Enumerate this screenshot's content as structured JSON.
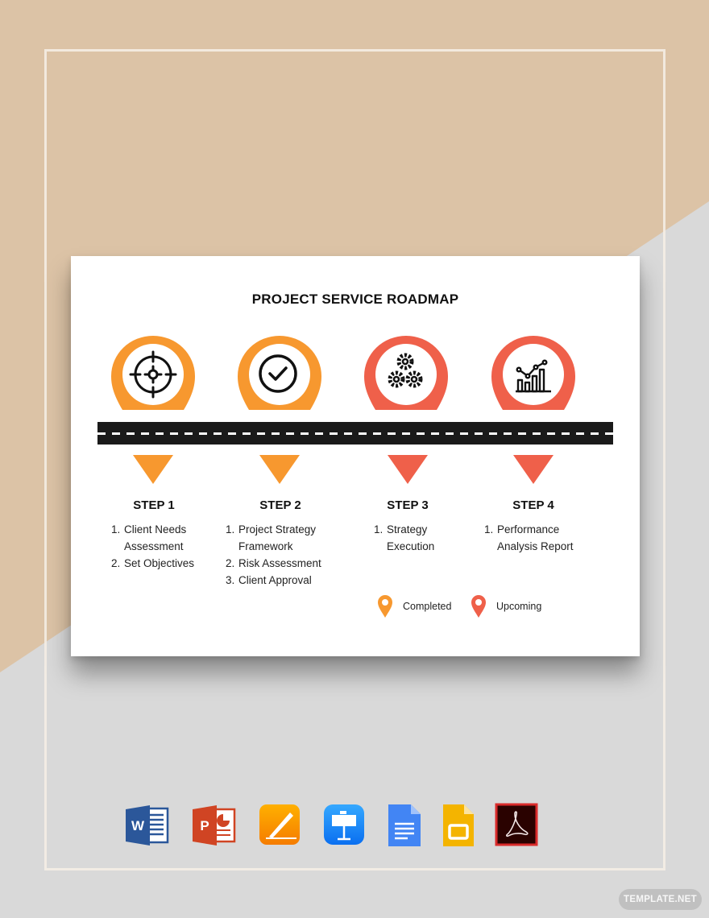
{
  "document": {
    "title": "PROJECT SERVICE ROADMAP",
    "colors": {
      "completed": "#f7982f",
      "upcoming": "#ef604a",
      "road": "#1a1a1a"
    },
    "steps": [
      {
        "label": "STEP 1",
        "status": "completed",
        "icon": "target-icon",
        "items": [
          {
            "num": "1.",
            "lines": [
              "Client Needs",
              "Assessment"
            ]
          },
          {
            "num": "2.",
            "lines": [
              "Set Objectives"
            ]
          }
        ]
      },
      {
        "label": "STEP 2",
        "status": "completed",
        "icon": "checkmark-circle-icon",
        "items": [
          {
            "num": "1.",
            "lines": [
              "Project Strategy",
              "Framework"
            ]
          },
          {
            "num": "2.",
            "lines": [
              "Risk Assessment"
            ]
          },
          {
            "num": "3.",
            "lines": [
              "Client Approval"
            ]
          }
        ]
      },
      {
        "label": "STEP 3",
        "status": "upcoming",
        "icon": "gears-icon",
        "items": [
          {
            "num": "1.",
            "lines": [
              "Strategy",
              "Execution"
            ]
          }
        ]
      },
      {
        "label": "STEP 4",
        "status": "upcoming",
        "icon": "growth-chart-icon",
        "items": [
          {
            "num": "1.",
            "lines": [
              "Performance",
              "Analysis Report"
            ]
          }
        ]
      }
    ],
    "legend": [
      {
        "label": "Completed",
        "status": "completed"
      },
      {
        "label": "Upcoming",
        "status": "upcoming"
      }
    ]
  },
  "formats": [
    {
      "name": "Microsoft Word",
      "icon": "word-icon"
    },
    {
      "name": "Microsoft PowerPoint",
      "icon": "powerpoint-icon"
    },
    {
      "name": "Apple Pages",
      "icon": "pages-icon"
    },
    {
      "name": "Apple Keynote",
      "icon": "keynote-icon"
    },
    {
      "name": "Google Docs",
      "icon": "google-docs-icon"
    },
    {
      "name": "Google Slides",
      "icon": "google-slides-icon"
    },
    {
      "name": "Adobe PDF",
      "icon": "adobe-pdf-icon"
    }
  ],
  "watermark": {
    "label": "TEMPLATE.NET"
  }
}
